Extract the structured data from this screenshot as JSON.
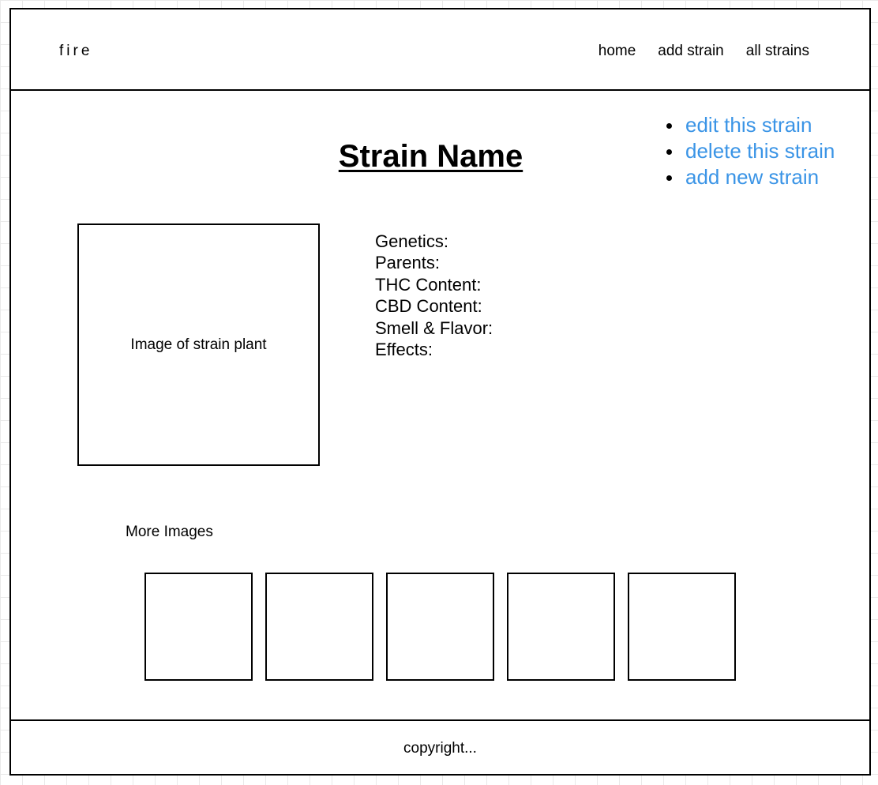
{
  "header": {
    "logo": "fire",
    "nav": [
      "home",
      "add strain",
      "all strains"
    ]
  },
  "page": {
    "title": "Strain Name"
  },
  "actions": [
    "edit this strain",
    "delete this strain",
    "add new strain"
  ],
  "main_image": {
    "label": "Image of strain plant"
  },
  "details": [
    "Genetics:",
    "Parents:",
    "THC Content:",
    "CBD Content:",
    "Smell & Flavor:",
    "Effects:"
  ],
  "more_images": {
    "label": "More Images",
    "count": 5
  },
  "footer": {
    "text": "copyright..."
  },
  "colors": {
    "link": "#3a94e6",
    "border": "#000000"
  }
}
